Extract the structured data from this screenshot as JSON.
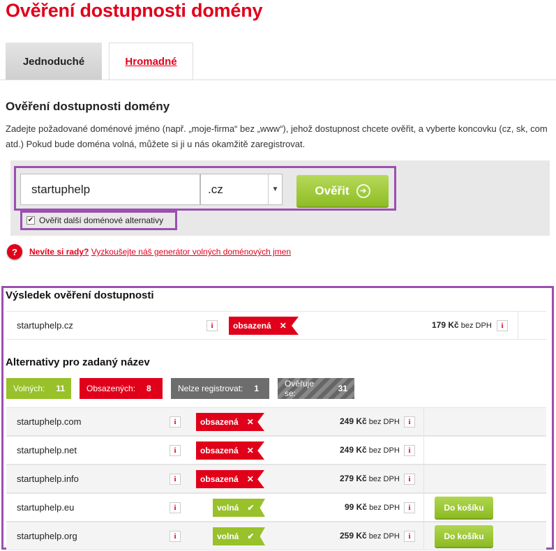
{
  "header": {
    "title": "Ověření dostupnosti domény"
  },
  "tabs": {
    "simple": "Jednoduché",
    "bulk": "Hromadné"
  },
  "form": {
    "heading": "Ověření dostupnosti domény",
    "description": "Zadejte požadované doménové jméno (např. „moje-firma“ bez „www“), jehož dostupnost chcete ověřit, a vyberte koncovku (cz, sk, com atd.) Pokud bude doména volná, můžete si ji u nás okamžitě zaregistrovat.",
    "domain_value": "startuphelp",
    "tld_value": ".cz",
    "verify_label": "Ověřit",
    "alternatives_label": "Ověřit další doménové alternativy",
    "alternatives_checked": true
  },
  "help": {
    "icon": "?",
    "strong": "Nevíte si rady?",
    "link": "Vyzkoušejte náš generátor volných doménových jmen"
  },
  "result": {
    "heading": "Výsledek ověření dostupnosti",
    "domain": "startuphelp.cz",
    "status": "obsazená",
    "price": "179 Kč",
    "price_suffix": "bez DPH",
    "info": "i"
  },
  "alternatives": {
    "heading": "Alternativy pro zadaný název",
    "filters": {
      "free_label": "Volných:",
      "free_count": "11",
      "taken_label": "Obsazených:",
      "taken_count": "8",
      "nr_label": "Nelze registrovat:",
      "nr_count": "1",
      "checking_label": "Ověřuje se:",
      "checking_count": "31"
    },
    "rows": [
      {
        "domain": "startuphelp.com",
        "status": "obsazená",
        "price": "249 Kč",
        "suffix": "bez DPH"
      },
      {
        "domain": "startuphelp.net",
        "status": "obsazená",
        "price": "249 Kč",
        "suffix": "bez DPH"
      },
      {
        "domain": "startuphelp.info",
        "status": "obsazená",
        "price": "279 Kč",
        "suffix": "bez DPH"
      },
      {
        "domain": "startuphelp.eu",
        "status": "volná",
        "price": "99 Kč",
        "suffix": "bez DPH",
        "cart": "Do košíku"
      },
      {
        "domain": "startuphelp.org",
        "status": "volná",
        "price": "259 Kč",
        "suffix": "bez DPH",
        "cart": "Do košíku"
      }
    ]
  },
  "colors": {
    "brand_red": "#e1001a",
    "accent_green": "#98c12a",
    "highlight_purple": "#9c4fb0"
  }
}
